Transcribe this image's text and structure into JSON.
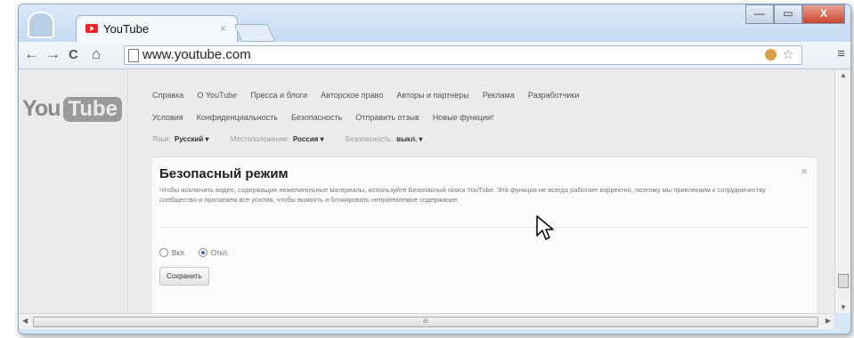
{
  "browser": {
    "tab_title": "YouTube",
    "tab_close": "×",
    "url": "www.youtube.com",
    "window_buttons": {
      "minimize": "—",
      "maximize": "▭",
      "close": "X"
    },
    "nav": {
      "back": "←",
      "forward": "→",
      "reload": "C",
      "home": "⌂"
    },
    "menu_icon": "≡",
    "star_icon": "☆"
  },
  "youtube": {
    "logo_you": "You",
    "logo_tube": "Tube",
    "links_row1": [
      "Справка",
      "О YouTube",
      "Пресса и блоги",
      "Авторское право",
      "Авторы и партнеры",
      "Реклама",
      "Разработчики"
    ],
    "links_row2": [
      "Условия",
      "Конфиденциальность",
      "Безопасность",
      "Отправить отзыв",
      "Новые функции!"
    ],
    "settings": {
      "language_label": "Язык:",
      "language_value": "Русский ▾",
      "location_label": "Местоположение:",
      "location_value": "Россия ▾",
      "safety_label": "Безопасность:",
      "safety_value": "выкл. ▾"
    },
    "safety_panel": {
      "title": "Безопасный режим",
      "description": "Чтобы исключить видео, содержащие нежелательные материалы, используйте Безопасный поиск YouTube. Эта функция не всегда работает корректно, поэтому мы привлекаем к сотрудничеству сообщество и прилагаем все усилия, чтобы выявить и блокировать неприемлемое содержание.",
      "option_on": "Вкл.",
      "option_off": "Откл.",
      "selected": "off",
      "save_label": "Сохранить",
      "close": "×"
    }
  },
  "scrollbar": {
    "thumb_grip": "III",
    "up": "▲",
    "down": "▼",
    "left": "◀",
    "right": "▶"
  }
}
